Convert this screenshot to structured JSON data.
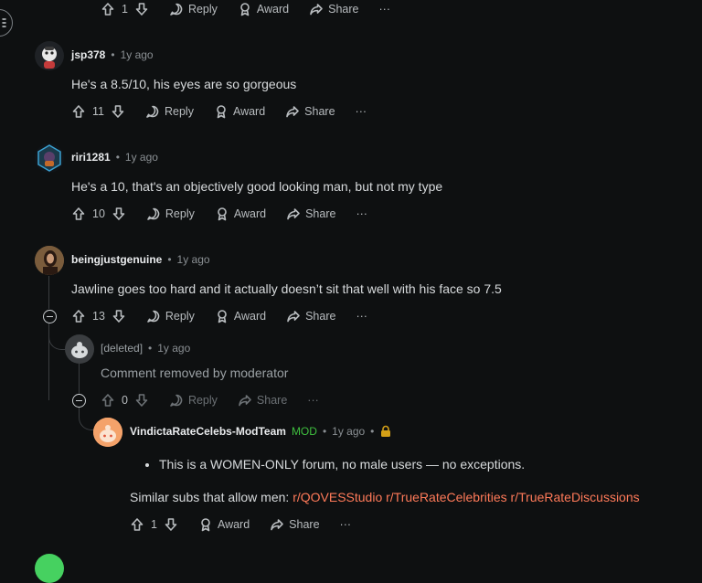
{
  "top_actions": {
    "votes": "1",
    "reply": "Reply",
    "award": "Award",
    "share": "Share",
    "more": "···"
  },
  "comments": [
    {
      "author": "jsp378",
      "age": "1y ago",
      "text": "He's a 8.5/10, his eyes are so gorgeous",
      "votes": "11"
    },
    {
      "author": "riri1281",
      "age": "1y ago",
      "text": "He's a 10, that's an objectively good looking man, but not my type",
      "votes": "10"
    },
    {
      "author": "beingjustgenuine",
      "age": "1y ago",
      "text": "Jawline goes too hard and it actually doesn’t sit that well with his face so 7.5",
      "votes": "13"
    },
    {
      "author": "[deleted]",
      "age": "1y ago",
      "text": "Comment removed by moderator",
      "votes": "0"
    },
    {
      "author": "VindictaRateCelebs-ModTeam",
      "mod_tag": "MOD",
      "age": "1y ago",
      "bullet": "This is a WOMEN-ONLY forum, no male users — no exceptions.",
      "similar_label": "Similar subs that allow men:",
      "subs": [
        "r/QOVESStudio",
        "r/TrueRateCelebrities",
        "r/TrueRateDiscussions"
      ],
      "votes": "1"
    }
  ],
  "labels": {
    "dot": "•",
    "reply": "Reply",
    "award": "Award",
    "share": "Share",
    "more": "···"
  },
  "colors": {
    "background": "#0e1011",
    "mod_green": "#3fbf3f",
    "link_orange": "#ff7a59",
    "lock_gold": "#d4a017"
  }
}
